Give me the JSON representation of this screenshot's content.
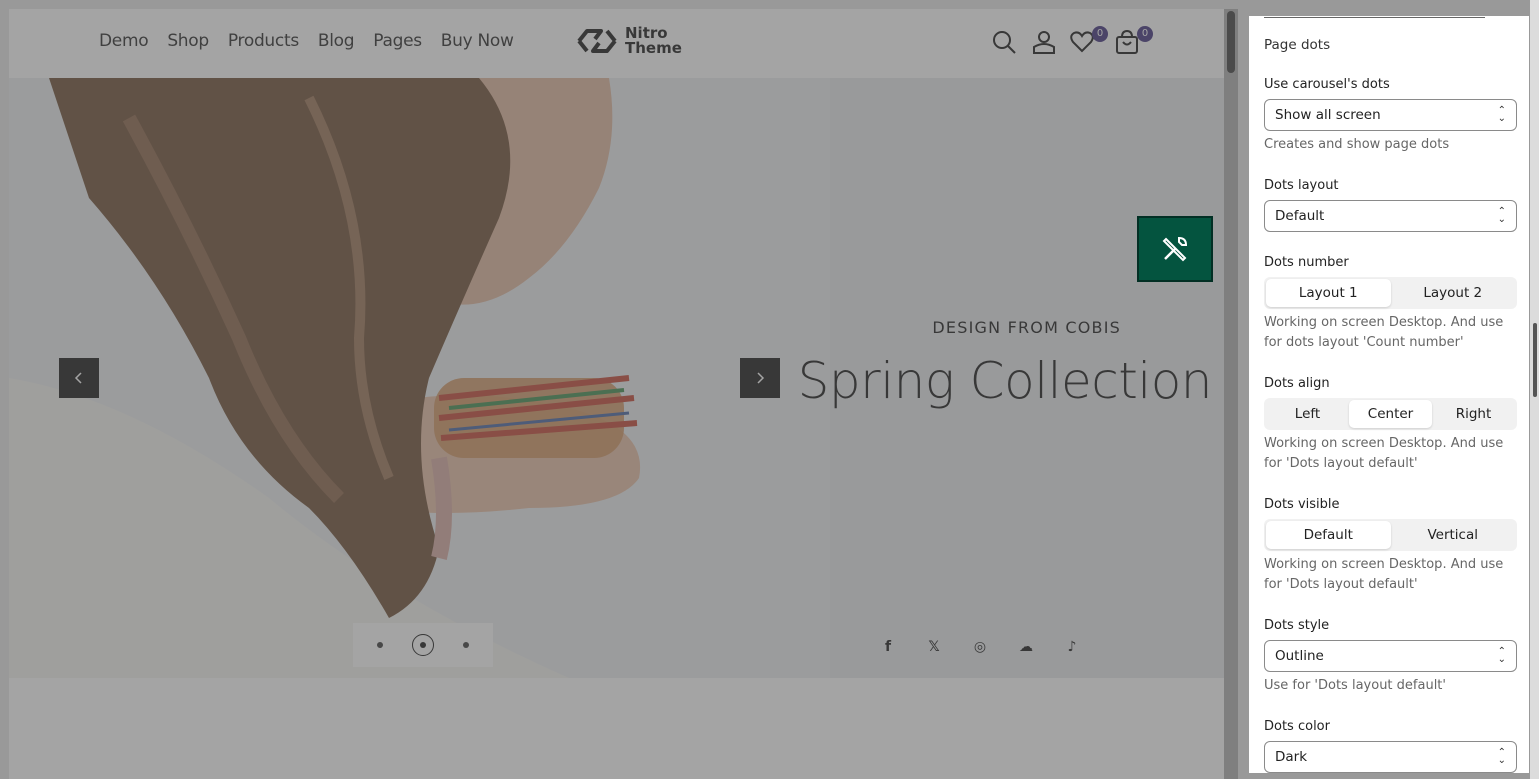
{
  "header": {
    "nav": [
      "Demo",
      "Shop",
      "Products",
      "Blog",
      "Pages",
      "Buy Now"
    ],
    "logo_line1": "Nitro",
    "logo_line2": "Theme",
    "wishlist_count": "0",
    "cart_count": "0",
    "icons": [
      "search-icon",
      "account-icon",
      "wishlist-icon",
      "cart-icon"
    ]
  },
  "hero": {
    "eyebrow": "DESIGN FROM COBIS",
    "headline": "Spring Collection",
    "prev_icon": "chevron-left-icon",
    "next_icon": "chevron-right-icon",
    "dots_total": 3,
    "active_dot": 2,
    "social": [
      "f",
      "𝕏",
      "◎",
      "☁",
      "♪"
    ],
    "social_names": [
      "facebook-icon",
      "x-icon",
      "instagram-icon",
      "soundcloud-icon",
      "tiktok-icon"
    ],
    "brand_color": "#04543f"
  },
  "panel": {
    "section_title": "Page dots",
    "use_dots_label": "Use carousel's dots",
    "use_dots_value": "Show all screen",
    "use_dots_help": "Creates and show page dots",
    "dots_layout_label": "Dots layout",
    "dots_layout_value": "Default",
    "dots_number_label": "Dots number",
    "dots_number_opt1": "Layout 1",
    "dots_number_opt2": "Layout 2",
    "dots_number_help": "Working on screen Desktop. And use for dots layout 'Count number'",
    "dots_align_label": "Dots align",
    "align_left": "Left",
    "align_center": "Center",
    "align_right": "Right",
    "dots_align_help": "Working on screen Desktop. And use for 'Dots layout default'",
    "dots_visible_label": "Dots visible",
    "visible_default": "Default",
    "visible_vertical": "Vertical",
    "dots_visible_help": "Working on screen Desktop. And use for 'Dots layout default'",
    "dots_style_label": "Dots style",
    "dots_style_value": "Outline",
    "dots_style_help": "Use for 'Dots layout default'",
    "dots_color_label": "Dots color",
    "dots_color_value": "Dark"
  }
}
